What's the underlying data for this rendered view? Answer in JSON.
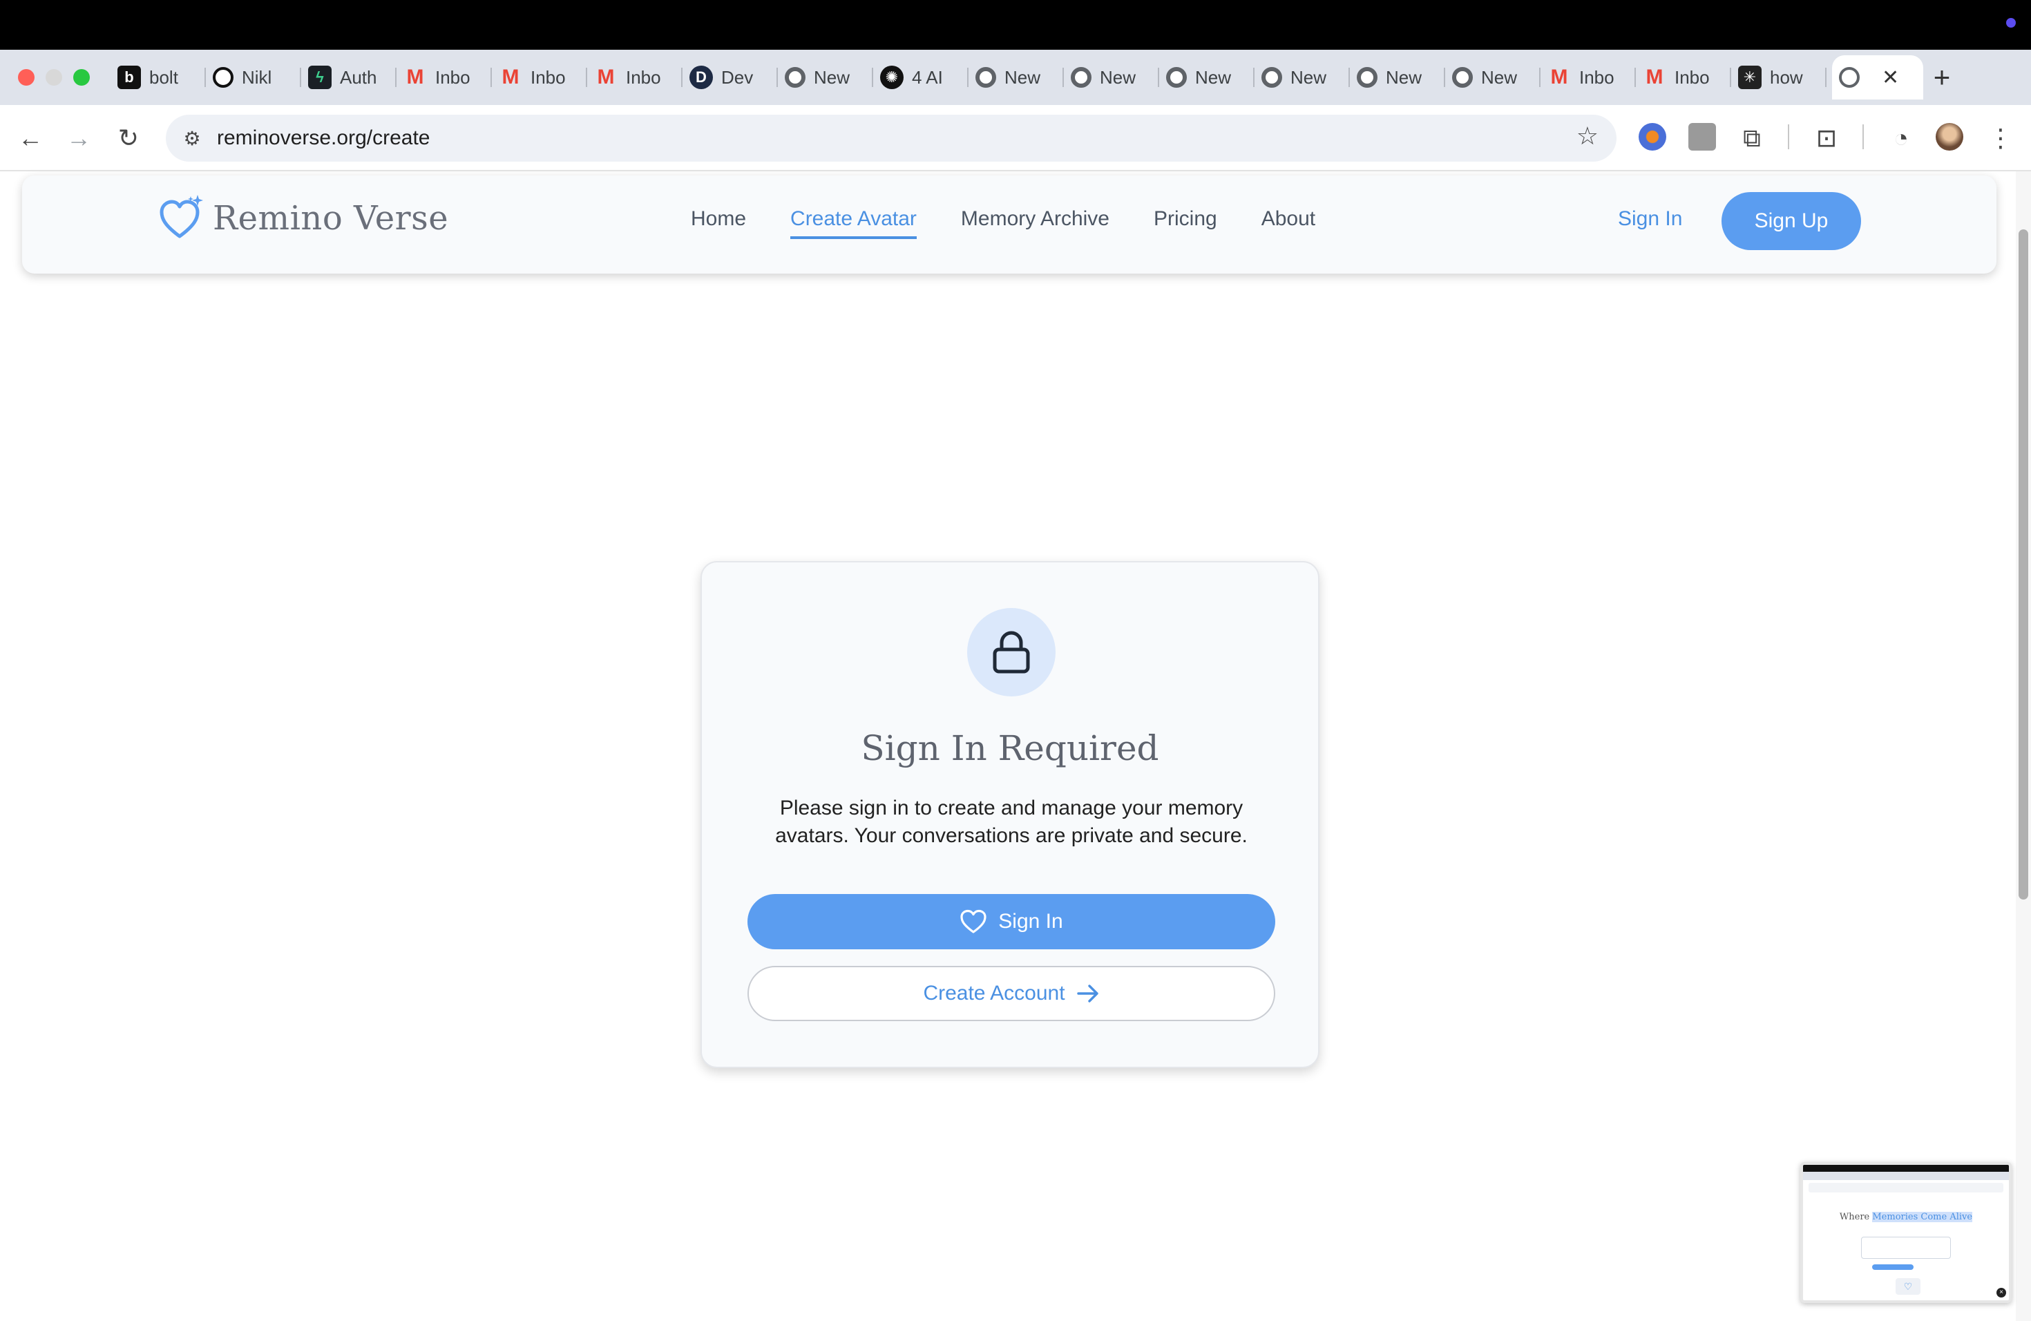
{
  "browser": {
    "tabs": [
      {
        "label": "bolt",
        "icon": "bolt-favicon"
      },
      {
        "label": "Nikl",
        "icon": "github-favicon"
      },
      {
        "label": "Auth",
        "icon": "supabase-favicon"
      },
      {
        "label": "Inbo",
        "icon": "gmail-favicon"
      },
      {
        "label": "Inbo",
        "icon": "gmail-favicon"
      },
      {
        "label": "Inbo",
        "icon": "gmail-favicon"
      },
      {
        "label": "Dev",
        "icon": "dev-favicon"
      },
      {
        "label": "New",
        "icon": "chrome-favicon"
      },
      {
        "label": "4 AI",
        "icon": "openai-favicon"
      },
      {
        "label": "New",
        "icon": "chrome-favicon"
      },
      {
        "label": "New",
        "icon": "chrome-favicon"
      },
      {
        "label": "New",
        "icon": "chrome-favicon"
      },
      {
        "label": "New",
        "icon": "chrome-favicon"
      },
      {
        "label": "New",
        "icon": "chrome-favicon"
      },
      {
        "label": "New",
        "icon": "chrome-favicon"
      },
      {
        "label": "Inbo",
        "icon": "gmail-favicon"
      },
      {
        "label": "Inbo",
        "icon": "gmail-favicon"
      },
      {
        "label": "how",
        "icon": "perplexity-favicon"
      }
    ],
    "active_tab_close": "✕",
    "new_tab": "+",
    "url": "reminoverse.org/create"
  },
  "site": {
    "brand": "Remino Verse",
    "nav": {
      "home": "Home",
      "create_avatar": "Create Avatar",
      "memory_archive": "Memory Archive",
      "pricing": "Pricing",
      "about": "About"
    },
    "sign_in": "Sign In",
    "sign_up": "Sign Up"
  },
  "card": {
    "title": "Sign In Required",
    "text": "Please sign in to create and manage your memory avatars. Your conversations are private and secure.",
    "sign_in_button": "Sign In",
    "create_account_button": "Create Account"
  },
  "thumbnail": {
    "heading_prefix": "Where ",
    "heading_highlight": "Memories Come Alive"
  },
  "colors": {
    "accent": "#5b9df0",
    "link": "#4a90e2",
    "lock_bg": "#dbe8fb"
  }
}
